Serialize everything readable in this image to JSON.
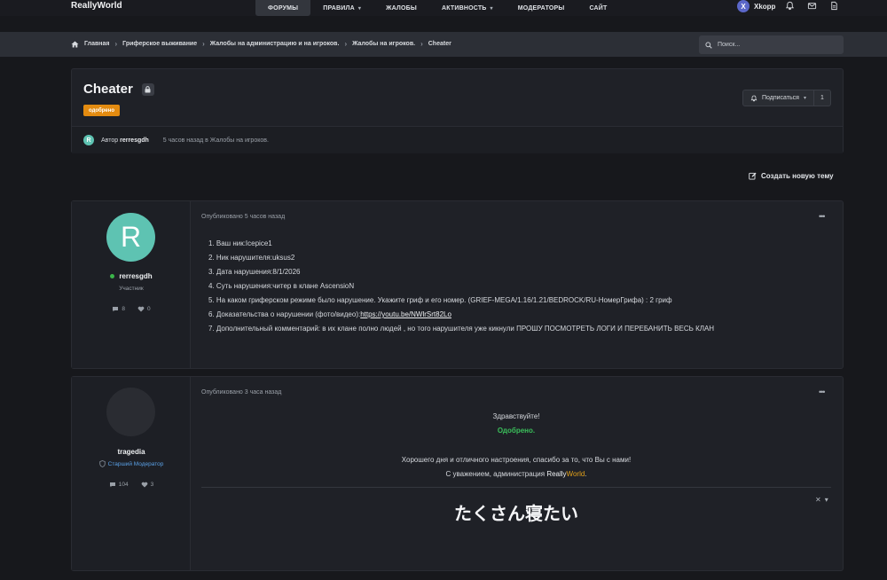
{
  "brand": "ReallyWorld",
  "nav": [
    {
      "label": "ФОРУМЫ",
      "active": true,
      "caret": false
    },
    {
      "label": "ПРАВИЛА",
      "active": false,
      "caret": true
    },
    {
      "label": "ЖАЛОБЫ",
      "active": false,
      "caret": false
    },
    {
      "label": "АКТИВНОСТЬ",
      "active": false,
      "caret": true
    },
    {
      "label": "МОДЕРАТОРЫ",
      "active": false,
      "caret": false
    },
    {
      "label": "САЙТ",
      "active": false,
      "caret": false
    }
  ],
  "user": {
    "initial": "X",
    "name": "Xkopp"
  },
  "breadcrumb": [
    "Главная",
    "Гриферское выживание",
    "Жалобы на администрацию и на игроков.",
    "Жалобы на игроков.",
    "Cheater"
  ],
  "search": {
    "placeholder": "Поиск..."
  },
  "topic": {
    "title": "Cheater",
    "badge": "одобрено",
    "follow_label": "Подписаться",
    "follow_count": "1",
    "author_initial": "R",
    "author_prefix": "Автор",
    "author": "rerresgdh",
    "time": "5 часов назад в Жалобы на игроков."
  },
  "new_topic": "Создать новую тему",
  "posts": [
    {
      "avatar_initial": "R",
      "name": "rerresgdh",
      "role": "Участник",
      "comments": "8",
      "likes": "0",
      "date": "Опубликовано 5 часов назад",
      "lines": [
        "1. Ваш ник:Icepice1",
        "2. Ник нарушителя:uksus2",
        "3. Дата нарушения:8/1/2026",
        "4. Суть нарушения:читер в клане AscensioN",
        "5. На каком гриферском режиме было нарушение. Укажите гриф и его номер. (GRIEF-MEGA/1.16/1.21/BEDROCK/RU-НомерГрифа) : 2 гриф",
        "6. Доказательства о нарушении (фото/видео):",
        "7. Дополнительный комментарий: в их клане полно людей , но того нарушителя уже кикнули ПРОШУ ПОСМОТРЕТЬ ЛОГИ И ПЕРЕБАНИТЬ ВЕСЬ КЛАН"
      ],
      "link": "https://youtu.be/NWlrSrt82Lo"
    },
    {
      "name": "tragedia",
      "role": "Старший Модератор",
      "comments": "104",
      "likes": "3",
      "date": "Опубликовано 3 часа назад",
      "greeting": "Здравствуйте!",
      "status": "Одобрено.",
      "wish": "Хорошего дня и отличного настроения, спасибо за то, что Вы с нами!",
      "sign_prefix": "С уважением, администрация ",
      "sign_really": "Really",
      "sign_world": "World",
      "sign_dot": ".",
      "signature": "たくさん寝たい"
    }
  ],
  "colors": {
    "accent": "#e38b10",
    "approved": "#3bbf5b",
    "moderator": "#5aa0e6",
    "avatar_r": "#5ec3b2"
  }
}
